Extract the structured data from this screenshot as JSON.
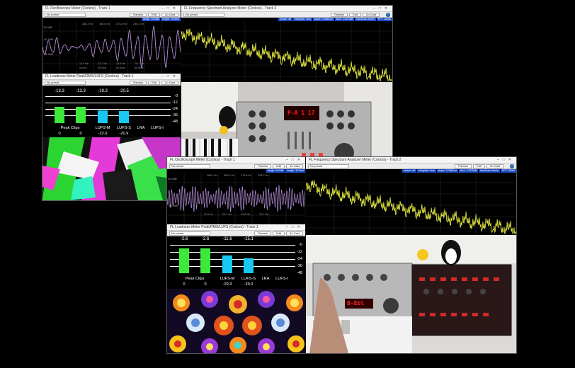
{
  "colors": {
    "meter_green": "#3ce83a",
    "meter_cyan": "#18c8f0",
    "spectrum_yellow": "#eef244",
    "wave_purple": "#b48ed8",
    "info_blue": "#1d4ec8",
    "icon_blue": "#1f5fa8"
  },
  "toolbar": {
    "preset": "No preset",
    "params": "Params",
    "edit": "Edit",
    "zero_crossing": "Zo Cast",
    "help": "?"
  },
  "icons": {
    "window_controls": [
      "minimize-icon",
      "maximize-icon",
      "close-icon"
    ]
  },
  "windows": {
    "osc_title": "FL Oscilloscope Meter (Cockos) - Track 1",
    "spectrum_title": "FL Frequency Spectrum Analyzer Meter (Cockos) - Track 2",
    "loud_title": "FL Loudness Meter Peak/RMS/LUFS (Cockos) - Track 1",
    "osc_info": [
      "range: 14.0dB",
      "length: 10.0ms"
    ],
    "spectrum_info": [
      "phase: off",
      "integrate: 0ms",
      "slope: 3.0dB/oct",
      "floor: -120.0dB",
      "blackman-harris",
      "FFT: 16384"
    ],
    "osc_db_top": "16.0dB",
    "osc_db_mid": "-97.0dB",
    "osc_db_bot": "-16.0dB",
    "osc_freqs": [
      "268.3 Hz",
      "365.6 Hz",
      "274.8 Hz",
      "235.2 Hz",
      "11.9 Hz",
      "23.7 Hz",
      "23.8 Hz",
      "79.7 Hz"
    ],
    "osc_times": [
      "0.0ms",
      "45.2ms",
      "62.5ms",
      "95.9ms",
      "62.0ms",
      "68.3ms",
      "69.5ms",
      "61.6ms"
    ]
  },
  "meters_top": {
    "peaks": [
      "-13.3",
      "-13.3",
      "-19.3",
      "-20.5"
    ],
    "levels": [
      0.6,
      0.6,
      0.48,
      0.46
    ],
    "labels": [
      "Peak Clips",
      "LUFS-M",
      "LUFS-S",
      "LRA",
      "LUFS-I"
    ],
    "values": [
      "0",
      "0",
      "-22.0",
      "-20.9"
    ],
    "clips": [
      "0",
      "0"
    ]
  },
  "meters_bottom": {
    "peaks": [
      "-2.6",
      "-2.6",
      "-11.6",
      "-15.1"
    ],
    "levels": [
      0.92,
      0.92,
      0.66,
      0.56
    ],
    "labels": [
      "Peak Clips",
      "LUFS-M",
      "LUFS-S",
      "LRA",
      "LUFS-I"
    ],
    "values": [
      "0",
      "0",
      "-29.3",
      "-29.0"
    ],
    "clips": [
      "0",
      "0"
    ]
  },
  "db_scale": [
    "-0",
    "-12",
    "-24",
    "-36",
    "-48"
  ],
  "synth_display_top": "P-A 1 17",
  "synth_display_bottom": "B-Ebl"
}
